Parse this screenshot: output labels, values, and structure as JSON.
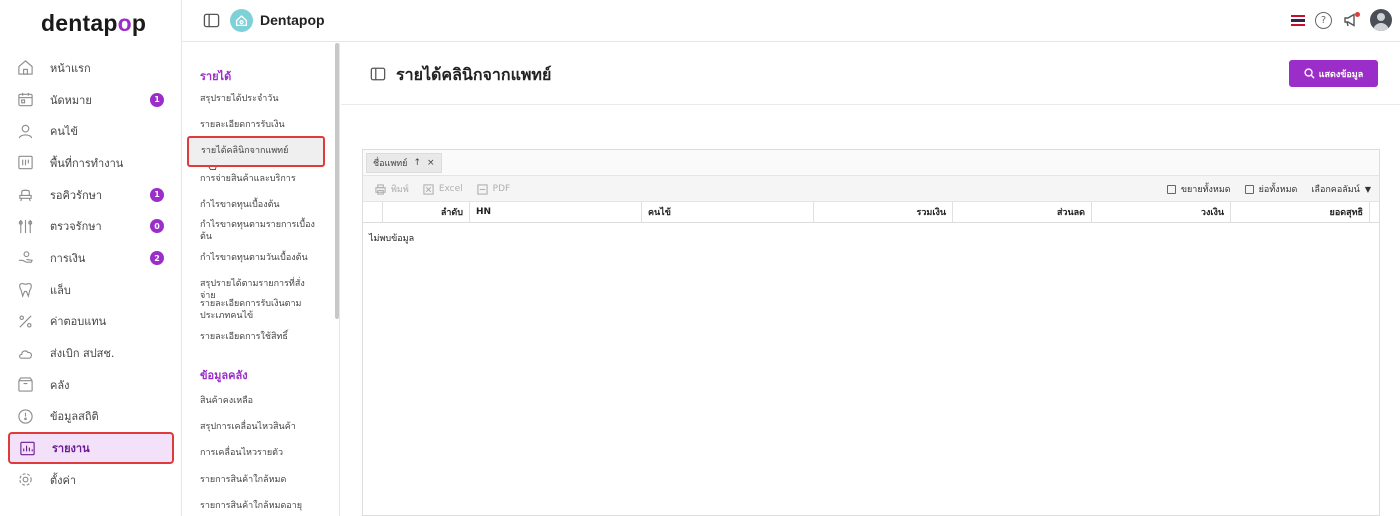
{
  "brand": {
    "logo_pre": "dentap",
    "logo_accent": "o",
    "logo_post": "p",
    "app_name": "Dentapop"
  },
  "sidebar": {
    "items": [
      {
        "label": "หน้าแรก",
        "icon": "home-icon",
        "badge": ""
      },
      {
        "label": "นัดหมาย",
        "icon": "calendar-icon",
        "badge": "1"
      },
      {
        "label": "คนไข้",
        "icon": "user-icon",
        "badge": ""
      },
      {
        "label": "พื้นที่การทำงาน",
        "icon": "workspace-icon",
        "badge": ""
      },
      {
        "label": "รอคิวรักษา",
        "icon": "chair-icon",
        "badge": "1"
      },
      {
        "label": "ตรวจรักษา",
        "icon": "tools-icon",
        "badge": "0"
      },
      {
        "label": "การเงิน",
        "icon": "money-hand-icon",
        "badge": "2"
      },
      {
        "label": "แล็บ",
        "icon": "tooth-icon",
        "badge": ""
      },
      {
        "label": "ค่าตอบแทน",
        "icon": "percent-icon",
        "badge": ""
      },
      {
        "label": "ส่งเบิก สปสช.",
        "icon": "cloud-icon",
        "badge": ""
      },
      {
        "label": "คลัง",
        "icon": "box-icon",
        "badge": ""
      },
      {
        "label": "ข้อมูลสถิติ",
        "icon": "stats-icon",
        "badge": ""
      },
      {
        "label": "รายงาน",
        "icon": "report-icon",
        "badge": ""
      },
      {
        "label": "ตั้งค่า",
        "icon": "gear-icon",
        "badge": ""
      }
    ],
    "active_index": 12
  },
  "submenu": {
    "sections": [
      {
        "title": "รายได้",
        "items": [
          "สรุปรายได้ประจำวัน",
          "รายละเอียดการรับเงิน",
          "รายได้คลินิกจากแพทย์",
          "การจ่ายสินค้าและบริการ",
          "กำไรขาดทุนเบื้องต้น",
          "กำไรขาดทุนตามรายการเบื้องต้น",
          "กำไรขาดทุนตามวันเบื้องต้น",
          "สรุปรายได้ตามรายการที่สั่งจ่าย",
          "รายละเอียดการรับเงินตามประเภทคนไข้",
          "รายละเอียดการใช้สิทธิ์"
        ]
      },
      {
        "title": "ข้อมูลคลัง",
        "items": [
          "สินค้าคงเหลือ",
          "สรุปการเคลื่อนไหวสินค้า",
          "การเคลื่อนไหวรายตัว",
          "รายการสินค้าใกล้หมด",
          "รายการสินค้าใกล้หมดอายุ"
        ]
      }
    ],
    "selected": "รายได้คลินิกจากแพทย์"
  },
  "page": {
    "title": "รายได้คลินิกจากแพทย์",
    "show_button": "แสดงข้อมูล"
  },
  "grid": {
    "group_chip": "ชื่อแพทย์",
    "toolbar_left": [
      "พิมพ์",
      "Excel",
      "PDF"
    ],
    "toolbar_right": [
      "ขยายทั้งหมด",
      "ย่อทั้งหมด",
      "เลือกคอลัมน์"
    ],
    "columns": [
      "ลำดับ",
      "HN",
      "คนไข้",
      "รวมเงิน",
      "ส่วนลด",
      "วงเงิน",
      "ยอดสุทธิ"
    ],
    "empty_text": "ไม่พบข้อมูล"
  },
  "colors": {
    "accent": "#9b2ec9",
    "highlight": "#e03a3a"
  }
}
